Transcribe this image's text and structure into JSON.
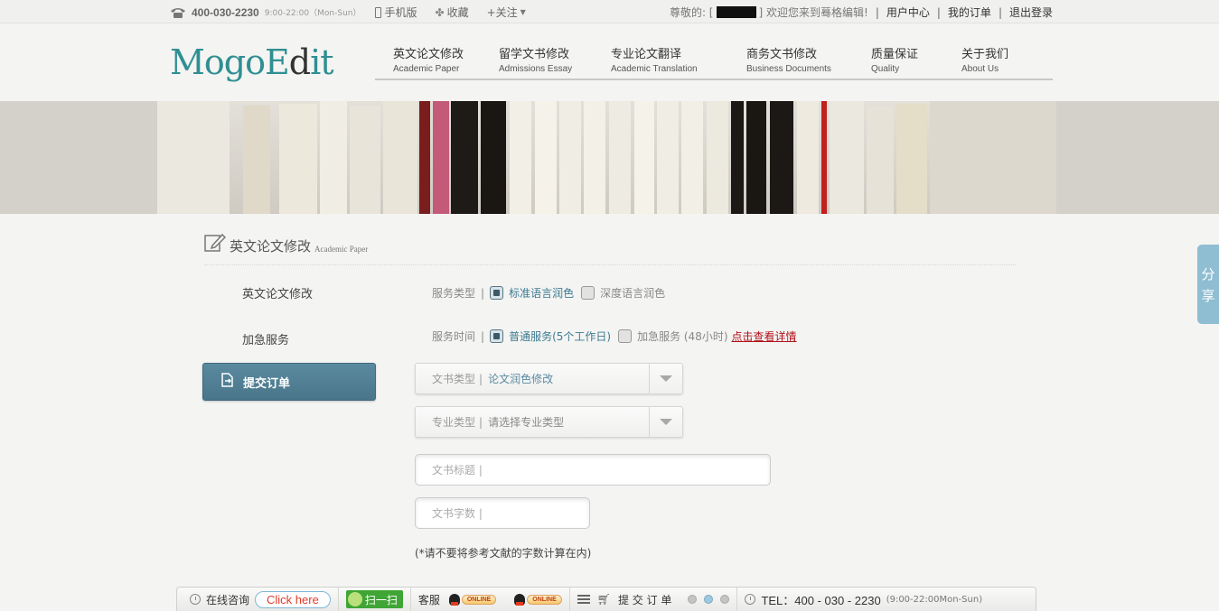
{
  "topbar": {
    "phone": "400-030-2230",
    "hours": "9:00-22:00（Mon-Sun）",
    "mobile": "手机版",
    "favorite": "收藏",
    "follow": "+关注",
    "greeting": "尊敬的: [",
    "greeting_end": "] 欢迎您来到蓦格编辑!",
    "user_center": "用户中心",
    "my_orders": "我的订单",
    "logout": "退出登录"
  },
  "logo": {
    "part1": "MogoE",
    "part2": "d",
    "part3": "it"
  },
  "nav": [
    {
      "cn": "英文论文修改",
      "en": "Academic Paper"
    },
    {
      "cn": "留学文书修改",
      "en": "Admissions Essay"
    },
    {
      "cn": "专业论文翻译",
      "en": "Academic Translation"
    },
    {
      "cn": "商务文书修改",
      "en": "Business Documents"
    },
    {
      "cn": "质量保证",
      "en": "Quality"
    },
    {
      "cn": "关于我们",
      "en": "About Us"
    }
  ],
  "section": {
    "title_cn": "英文论文修改",
    "title_en": "Academic Paper"
  },
  "side": {
    "item1": "英文论文修改",
    "item2": "加急服务",
    "submit": "提交订单"
  },
  "form": {
    "service_type_label": "服务类型",
    "service_type_opt1": "标准语言润色",
    "service_type_opt2": "深度语言润色",
    "service_time_label": "服务时间",
    "service_time_opt1": "普通服务(5个工作日)",
    "service_time_opt2": "加急服务 (48小时)",
    "details_link": "点击查看详情",
    "doc_type_label": "文书类型",
    "doc_type_value": "论文润色修改",
    "major_label": "专业类型",
    "major_value": "请选择专业类型",
    "title_placeholder": "文书标题 |",
    "words_placeholder": "文书字数 |",
    "note": "(*请不要将参考文献的字数计算在内)"
  },
  "share": {
    "line1": "分",
    "line2": "享"
  },
  "bottombar": {
    "consult": "在线咨询",
    "click_here": "Click here",
    "scan": "扫一扫",
    "service": "客服",
    "online": "ONLINE",
    "submit_order": "提 交 订 单",
    "tel": "TEL：400 - 030 - 2230",
    "tel_hours": "(9:00-22:00Mon-Sun)"
  },
  "colors": {
    "accent": "#4a7589",
    "brand": "#2f8f92",
    "link_red": "#b0121b"
  }
}
